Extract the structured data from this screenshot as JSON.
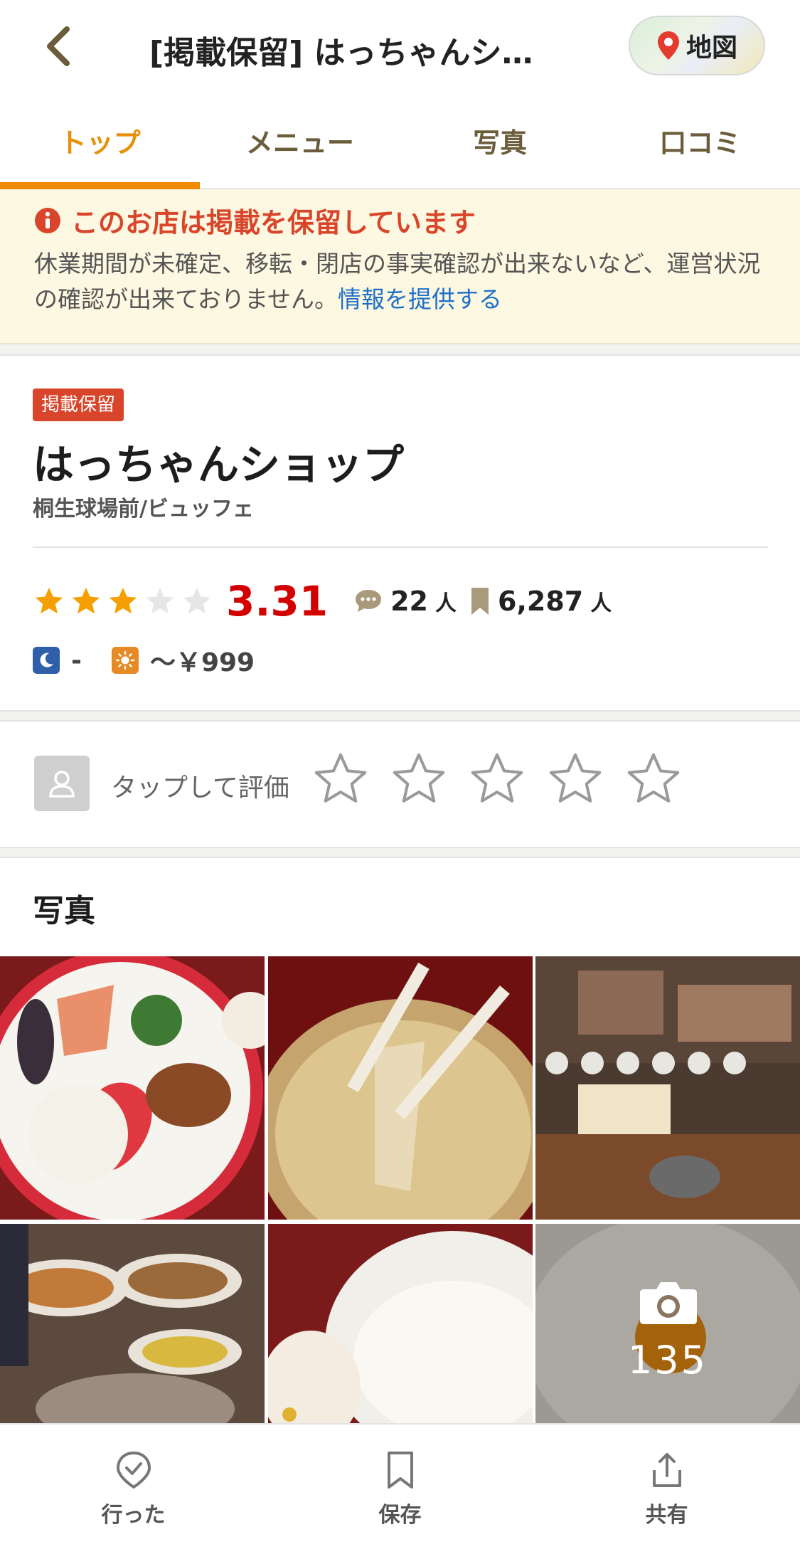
{
  "header": {
    "title": "[掲載保留] はっちゃんシ…",
    "map_label": "地図"
  },
  "tabs": [
    {
      "label": "トップ",
      "active": true
    },
    {
      "label": "メニュー",
      "active": false
    },
    {
      "label": "写真",
      "active": false
    },
    {
      "label": "口コミ",
      "active": false
    }
  ],
  "notice": {
    "title": "このお店は掲載を保留しています",
    "body": "休業期間が未確定、移転・閉店の事実確認が出来ないなど、運営状況の確認が出来ておりません。",
    "link": "情報を提供する"
  },
  "shop": {
    "badge": "掲載保留",
    "name": "はっちゃんショップ",
    "sub": "桐生球場前/ビュッフェ",
    "rating": "3.31",
    "rating_value": 3.31,
    "reviews_count": "22",
    "reviews_unit": "人",
    "saved_count": "6,287",
    "saved_unit": "人",
    "dinner_price": "-",
    "lunch_price": "～￥999"
  },
  "rate": {
    "label": "タップして評価"
  },
  "photos": {
    "title": "写真",
    "count": "135"
  },
  "bottom_bar": {
    "went_label": "行った",
    "save_label": "保存",
    "share_label": "共有"
  },
  "colors": {
    "accent": "#f08a00",
    "rating": "#d40000",
    "notice_bg": "#fcf8e1",
    "notice_title": "#d9452b",
    "link": "#1f6fc9"
  }
}
